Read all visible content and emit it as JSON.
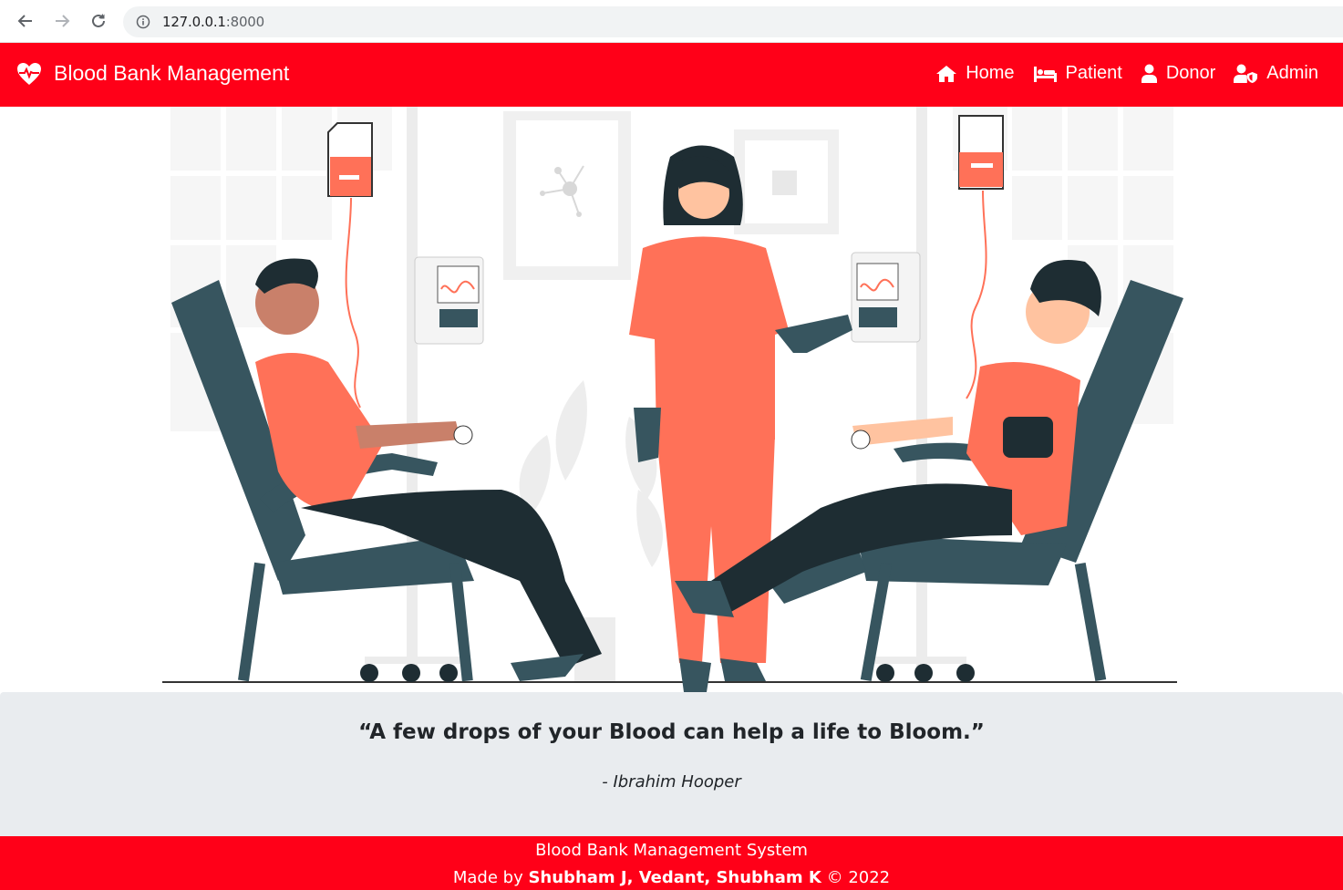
{
  "browser": {
    "url_host": "127.0.0.1",
    "url_port": ":8000"
  },
  "navbar": {
    "brand": "Blood Bank Management",
    "links": [
      {
        "label": "Home",
        "icon": "home-icon"
      },
      {
        "label": "Patient",
        "icon": "bed-icon"
      },
      {
        "label": "Donor",
        "icon": "user-icon"
      },
      {
        "label": "Admin",
        "icon": "user-shield-icon"
      }
    ]
  },
  "hero": {
    "illustration": "blood-donation-illustration"
  },
  "quote": {
    "text": "“A few drops of your Blood can help a life to Bloom.”",
    "author": "- Ibrahim Hooper"
  },
  "footer": {
    "title": "Blood Bank Management System",
    "made_by_prefix": "Made by",
    "authors": "Shubham J, Vedant, Shubham K",
    "copyright": "© 2022"
  },
  "colors": {
    "primary": "#ff0018",
    "jumbotron": "#e9ecef",
    "accent_orange": "#ff7158",
    "chair": "#37555f",
    "dark": "#1e2d33"
  }
}
